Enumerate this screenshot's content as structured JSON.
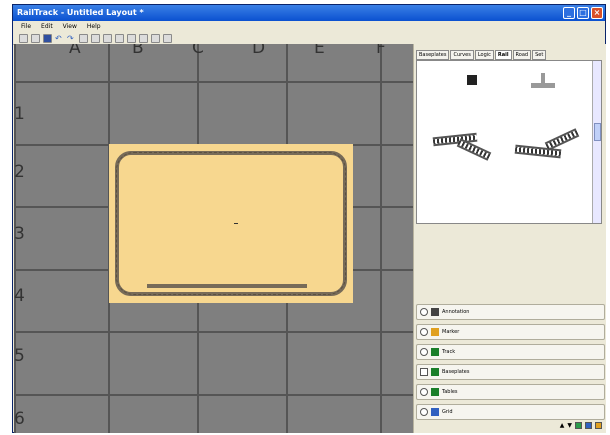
{
  "window": {
    "title": "RailTrack - Untitled Layout *"
  },
  "menu": {
    "items": [
      "File",
      "Edit",
      "View",
      "Help"
    ]
  },
  "grid": {
    "columns": [
      "A",
      "B",
      "C",
      "D",
      "E",
      "F"
    ],
    "rows": [
      "1",
      "2",
      "3",
      "4",
      "5",
      "6"
    ]
  },
  "palette": {
    "tabs": [
      "Baseplates",
      "Curves",
      "Logic",
      "Rail",
      "Road",
      "Set"
    ],
    "active_tab": "Rail"
  },
  "layers": [
    {
      "label": "Annotation"
    },
    {
      "label": "Marker"
    },
    {
      "label": "Track"
    },
    {
      "label": "Baseplates"
    },
    {
      "label": "Tables"
    },
    {
      "label": "Grid"
    }
  ],
  "colors": {
    "board": "#f7d78f",
    "track": "#776b58",
    "titlebar": "#0a50d0"
  }
}
